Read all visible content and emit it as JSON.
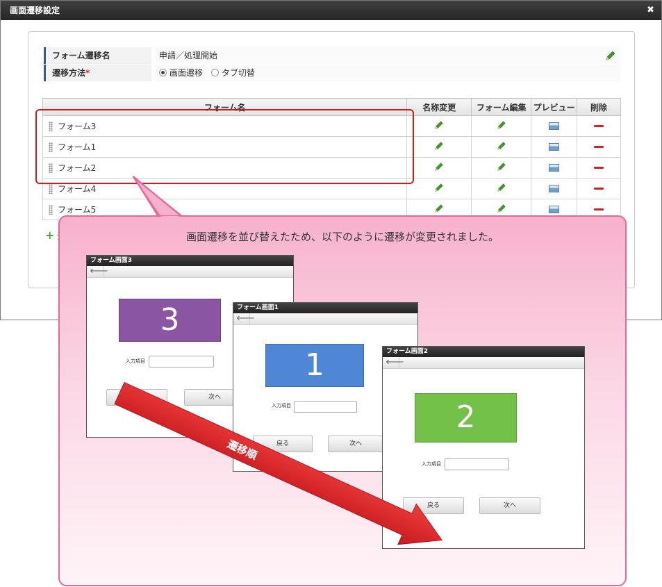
{
  "dialog": {
    "title": "画面遷移設定",
    "close_glyph": "✖"
  },
  "properties": {
    "name_label": "フォーム遷移名",
    "name_value": "申請／処理開始",
    "method_label": "遷移方法",
    "required_mark": "*",
    "method_options": [
      "画面遷移",
      "タブ切替"
    ],
    "method_selected": "画面遷移"
  },
  "table": {
    "headers": [
      "フォーム名",
      "名称変更",
      "フォーム編集",
      "プレビュー",
      "削除"
    ],
    "rows": [
      {
        "name": "フォーム3"
      },
      {
        "name": "フォーム1"
      },
      {
        "name": "フォーム2"
      },
      {
        "name": "フォーム4"
      },
      {
        "name": "フォーム5"
      }
    ],
    "add_label": "追加"
  },
  "callout": {
    "message": "画面遷移を並び替えたため、以下のように遷移が変更されました。",
    "arrow_label": "遷移順"
  },
  "mini_windows": [
    {
      "title": "フォーム画面3",
      "number": "3",
      "color": "#8a56a3",
      "input_label": "入力項目",
      "back_button": "戻る",
      "next_button": "次へ"
    },
    {
      "title": "フォーム画面1",
      "number": "1",
      "color": "#4f86d6",
      "input_label": "入力項目",
      "back_button": "戻る",
      "next_button": "次へ"
    },
    {
      "title": "フォーム画面2",
      "number": "2",
      "color": "#74c14a",
      "input_label": "入力項目",
      "back_button": "戻る",
      "next_button": "次へ"
    }
  ],
  "colors": {
    "highlight": "#d4191c",
    "callout_border": "#e6679a",
    "arrow": "#e0262b",
    "edit_icon": "#3a9a2c",
    "delete_icon": "#d72020"
  },
  "icons": {
    "rename": "pencil-icon",
    "edit": "pencil-icon",
    "preview": "image-icon",
    "delete": "minus-icon",
    "drag": "drag-handle-icon",
    "back": "arrow-left-icon",
    "add": "plus-icon"
  }
}
